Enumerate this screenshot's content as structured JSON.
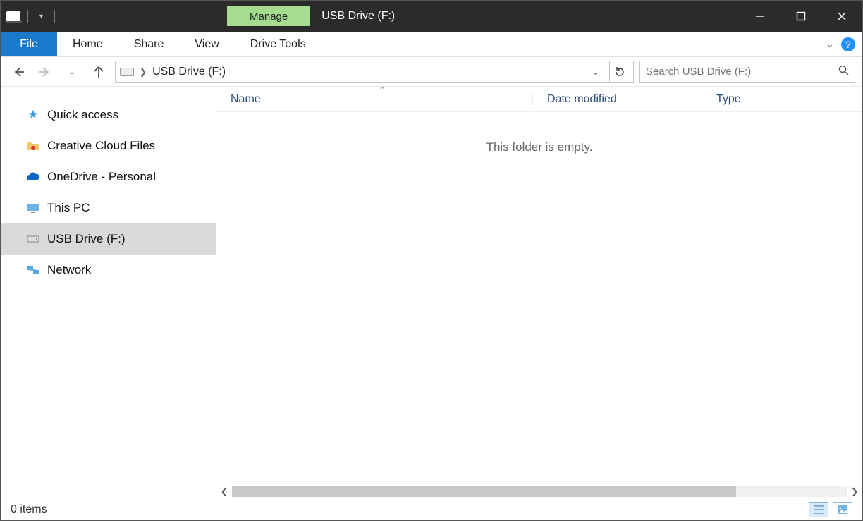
{
  "titlebar": {
    "contextual_label": "Manage",
    "window_title": "USB Drive (F:)"
  },
  "ribbon": {
    "file": "File",
    "tabs": [
      "Home",
      "Share",
      "View"
    ],
    "contextual_tab": "Drive Tools"
  },
  "address": {
    "crumb": "USB Drive (F:)"
  },
  "search": {
    "placeholder": "Search USB Drive (F:)"
  },
  "sidebar": {
    "items": [
      {
        "label": "Quick access",
        "icon": "star-icon",
        "color": "#3a9bdc"
      },
      {
        "label": "Creative Cloud Files",
        "icon": "folder-cc-icon",
        "color": "#f0a030"
      },
      {
        "label": "OneDrive - Personal",
        "icon": "cloud-icon",
        "color": "#0a66c2"
      },
      {
        "label": "This PC",
        "icon": "pc-icon",
        "color": "#3a9bdc"
      },
      {
        "label": "USB Drive (F:)",
        "icon": "drive-icon",
        "color": "#888",
        "selected": true
      },
      {
        "label": "Network",
        "icon": "network-icon",
        "color": "#2e8bd8"
      }
    ]
  },
  "columns": {
    "name": "Name",
    "date": "Date modified",
    "type": "Type"
  },
  "content": {
    "empty_message": "This folder is empty."
  },
  "status": {
    "item_count": "0 items"
  }
}
